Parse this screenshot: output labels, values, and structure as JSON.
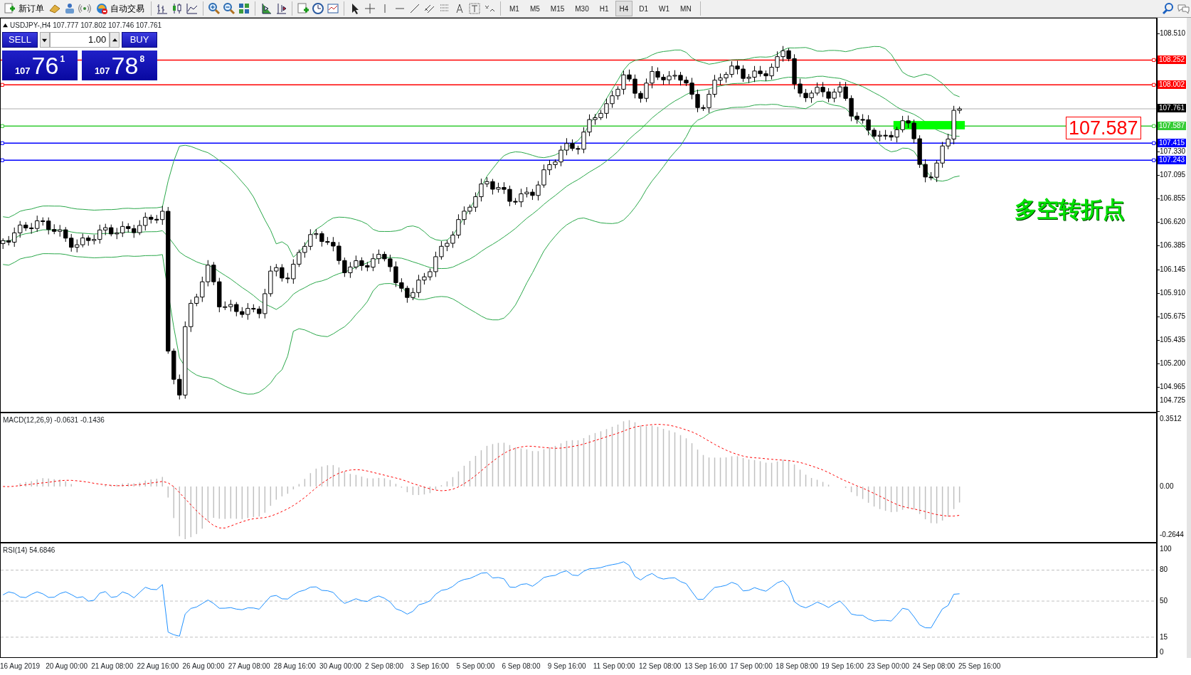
{
  "toolbar": {
    "buttons": [
      {
        "kind": "new-order",
        "label": "新订单"
      },
      {
        "kind": "auto-trading",
        "label": "自动交易"
      }
    ],
    "timeframes": [
      {
        "label": "M1",
        "selected": false
      },
      {
        "label": "M5",
        "selected": false
      },
      {
        "label": "M15",
        "selected": false
      },
      {
        "label": "M30",
        "selected": false
      },
      {
        "label": "H1",
        "selected": false
      },
      {
        "label": "H4",
        "selected": true
      },
      {
        "label": "D1",
        "selected": false
      },
      {
        "label": "W1",
        "selected": false
      },
      {
        "label": "MN",
        "selected": false
      }
    ]
  },
  "chart": {
    "title": "USDJPY-,H4  107.777 107.802 107.746 107.761",
    "trade_panel": {
      "sell_label": "SELL",
      "buy_label": "BUY",
      "lots": "1.00",
      "sell_price": {
        "big_figure": "107",
        "pips": "76",
        "fraction": "1"
      },
      "buy_price": {
        "big_figure": "107",
        "pips": "78",
        "fraction": "8"
      }
    },
    "price_axis": [
      "108.510",
      "107.330",
      "107.095",
      "106.855",
      "106.620",
      "106.385",
      "106.145",
      "105.910",
      "105.675",
      "105.435",
      "105.200",
      "104.965",
      "104.725"
    ],
    "levels": [
      {
        "kind": "line",
        "price": "108.252",
        "color": "#ff0000"
      },
      {
        "kind": "line",
        "price": "108.002",
        "color": "#ff0000"
      },
      {
        "kind": "bid",
        "price": "107.761",
        "color": "#000000"
      },
      {
        "kind": "line",
        "price": "107.587",
        "color": "#33cc33"
      },
      {
        "kind": "line",
        "price": "107.415",
        "color": "#0000ff"
      },
      {
        "kind": "line",
        "price": "107.243",
        "color": "#0000ff"
      }
    ],
    "annotations": {
      "price_box": "107.587",
      "note": "多空转折点"
    }
  },
  "macd": {
    "title": "MACD(12,26,9) -0.0631 -0.1436",
    "axis": [
      "0.3512",
      "0.00",
      "-0.2644"
    ]
  },
  "rsi": {
    "title": "RSI(14) 54.6846",
    "axis": [
      "100",
      "80",
      "50",
      "15",
      "0"
    ]
  },
  "time_axis": [
    "16 Aug 2019",
    "20 Aug 00:00",
    "21 Aug 08:00",
    "22 Aug 16:00",
    "26 Aug 00:00",
    "27 Aug 08:00",
    "28 Aug 16:00",
    "30 Aug 00:00",
    "2 Sep 08:00",
    "3 Sep 16:00",
    "5 Sep 00:00",
    "6 Sep 08:00",
    "9 Sep 16:00",
    "11 Sep 00:00",
    "12 Sep 08:00",
    "13 Sep 16:00",
    "17 Sep 00:00",
    "18 Sep 08:00",
    "19 Sep 16:00",
    "23 Sep 00:00",
    "24 Sep 08:00",
    "25 Sep 16:00"
  ]
}
